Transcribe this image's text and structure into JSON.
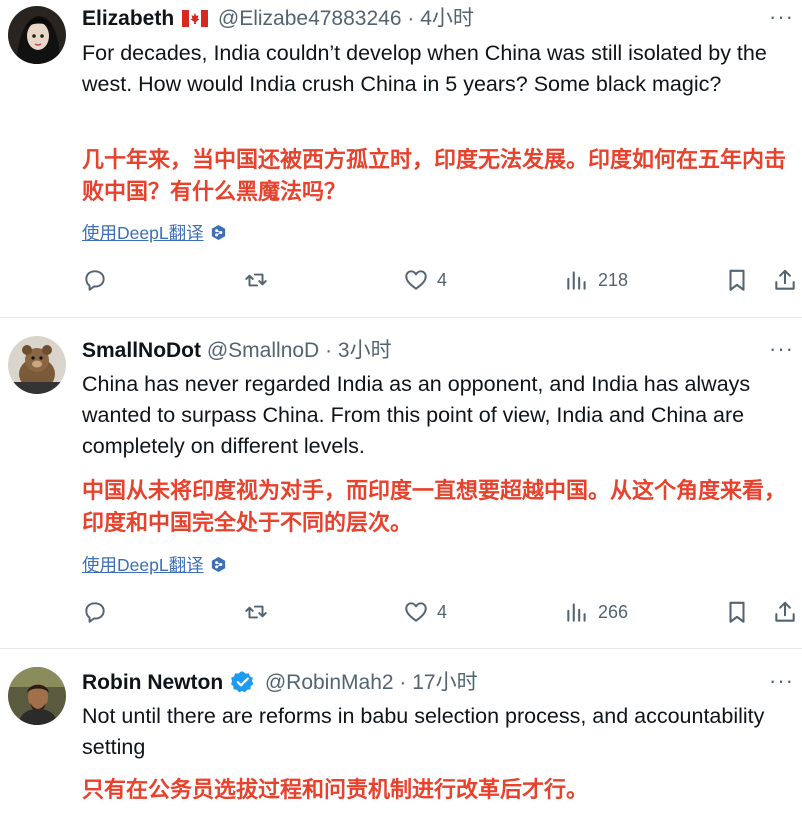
{
  "tweets": [
    {
      "name": "Elizabeth",
      "handle": "@Elizabe47883246",
      "dot": "·",
      "time": "4小时",
      "more": "···",
      "text_en": "For decades, India couldn’t develop when China was still isolated by the west. How would India crush China in 5 years? Some black magic?",
      "text_zh": "几十年来，当中国还被西方孤立时，印度无法发展。印度如何在五年内击败中国？有什么黑魔法吗？",
      "translate_label": "使用DeepL翻译",
      "likes": "4",
      "views": "218"
    },
    {
      "name": "SmallNoDot",
      "handle": "@SmallnoD",
      "dot": "·",
      "time": "3小时",
      "more": "···",
      "text_en": "China has never regarded India as an opponent, and India has always wanted to surpass China. From this point of view, India and China are completely on different levels.",
      "text_zh": "中国从未将印度视为对手，而印度一直想要超越中国。从这个角度来看，印度和中国完全处于不同的层次。",
      "translate_label": "使用DeepL翻译",
      "likes": "4",
      "views": "266"
    },
    {
      "name": "Robin Newton",
      "handle": "@RobinMah2",
      "dot": "·",
      "time": "17小时",
      "more": "···",
      "text_en": "Not until there are reforms in babu selection process, and accountability setting",
      "text_zh": "只有在公务员选拔过程和问责机制进行改革后才行。"
    }
  ],
  "colors": {
    "text": "#0f1419",
    "muted": "#536471",
    "translation": "#e8412c",
    "link": "#3d6fb6",
    "verified": "#1d9bf0"
  },
  "icons": [
    "reply-icon",
    "retweet-icon",
    "heart-icon",
    "views-icon",
    "bookmark-icon",
    "share-icon",
    "more-icon",
    "verified-icon",
    "canada-flag-icon",
    "deepl-icon"
  ]
}
